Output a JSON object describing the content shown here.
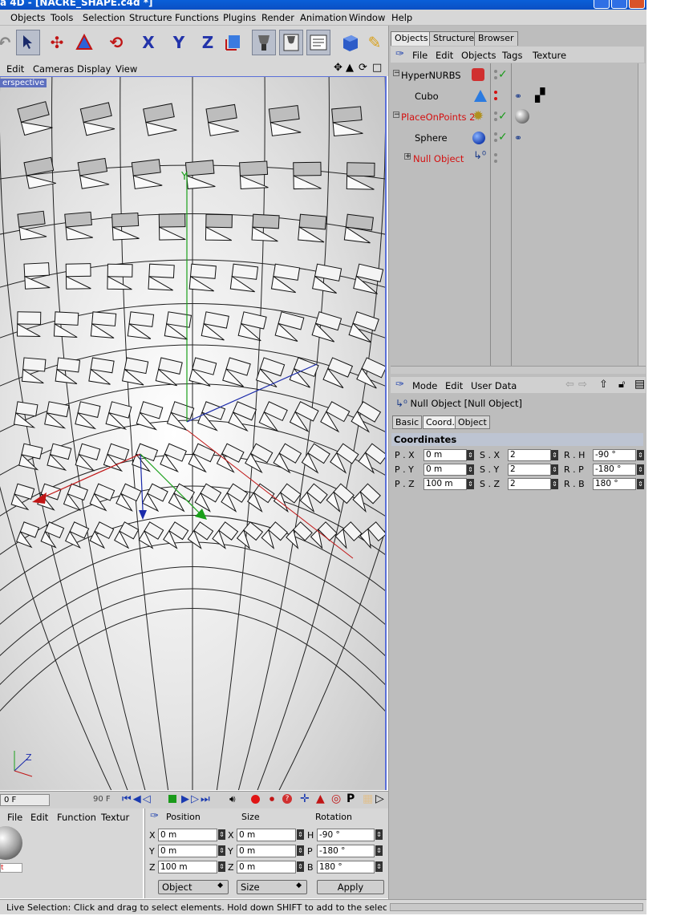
{
  "window": {
    "title": "a 4D - [NACRE_SHAPE.c4d *]"
  },
  "menubar": [
    "Objects",
    "Tools",
    "Selection",
    "Structure",
    "Functions",
    "Plugins",
    "Render",
    "Animation",
    "Window",
    "Help"
  ],
  "toolbar": {
    "icons": [
      "undo-icon",
      "live-selection-icon",
      "move-icon",
      "scale-icon",
      "rotate-icon",
      "x-axis-lock-icon",
      "y-axis-lock-icon",
      "z-axis-lock-icon",
      "coordinate-system-icon",
      "render-view-icon",
      "render-picture-viewer-icon",
      "render-settings-icon",
      "cube-icon",
      "pen-icon"
    ],
    "x_label": "X",
    "y_label": "Y",
    "z_label": "Z"
  },
  "viewport": {
    "menu": [
      "Edit",
      "Cameras",
      "Display",
      "View"
    ],
    "label": "erspective",
    "axis_y": "Y",
    "axis_z": "Z"
  },
  "objects_panel": {
    "tabs": [
      "Objects",
      "Structure",
      "Browser"
    ],
    "menu": [
      "File",
      "Edit",
      "Objects",
      "Tags",
      "Texture"
    ],
    "items": [
      {
        "name": "HyperNURBS",
        "color": "#000000",
        "icon": "hypernurbs-icon"
      },
      {
        "name": "Cubo",
        "color": "#000000",
        "icon": "cube-object-icon"
      },
      {
        "name": "PlaceOnPoints 2",
        "color": "#d41010",
        "icon": "placeonpoints-icon"
      },
      {
        "name": "Sphere",
        "color": "#000000",
        "icon": "sphere-icon"
      },
      {
        "name": "Null Object",
        "color": "#d41010",
        "icon": "null-object-icon"
      }
    ]
  },
  "attributes": {
    "menu": [
      "Mode",
      "Edit",
      "User Data"
    ],
    "title": "Null Object [Null Object]",
    "tabs": [
      "Basic",
      "Coord.",
      "Object"
    ],
    "section": "Coordinates",
    "rows": [
      {
        "p_label": "P . X",
        "p": "0 m",
        "s_label": "S . X",
        "s": "2",
        "r_label": "R . H",
        "r": "-90 °"
      },
      {
        "p_label": "P . Y",
        "p": "0 m",
        "s_label": "S . Y",
        "s": "2",
        "r_label": "R . P",
        "r": "-180 °"
      },
      {
        "p_label": "P . Z",
        "p": "100 m",
        "s_label": "S . Z",
        "s": "2",
        "r_label": "R . B",
        "r": "180 °"
      }
    ]
  },
  "timeline": {
    "start": "0 F",
    "end": "90 F"
  },
  "materials": {
    "menu": [
      "File",
      "Edit",
      "Function",
      "Textur"
    ],
    "label": "t"
  },
  "coordinates_manager": {
    "headers": [
      "Position",
      "Size",
      "Rotation"
    ],
    "rows": [
      {
        "a": "X",
        "pos": "0 m",
        "b": "X",
        "size": "0 m",
        "c": "H",
        "rot": "-90 °"
      },
      {
        "a": "Y",
        "pos": "0 m",
        "b": "Y",
        "size": "0 m",
        "c": "P",
        "rot": "-180 °"
      },
      {
        "a": "Z",
        "pos": "100 m",
        "b": "Z",
        "size": "0 m",
        "c": "B",
        "rot": "180 °"
      }
    ],
    "mode": "Object",
    "size_mode": "Size",
    "apply": "Apply"
  },
  "status": "Live Selection: Click and drag to select elements. Hold down SHIFT to add to the selection, CTRL to"
}
